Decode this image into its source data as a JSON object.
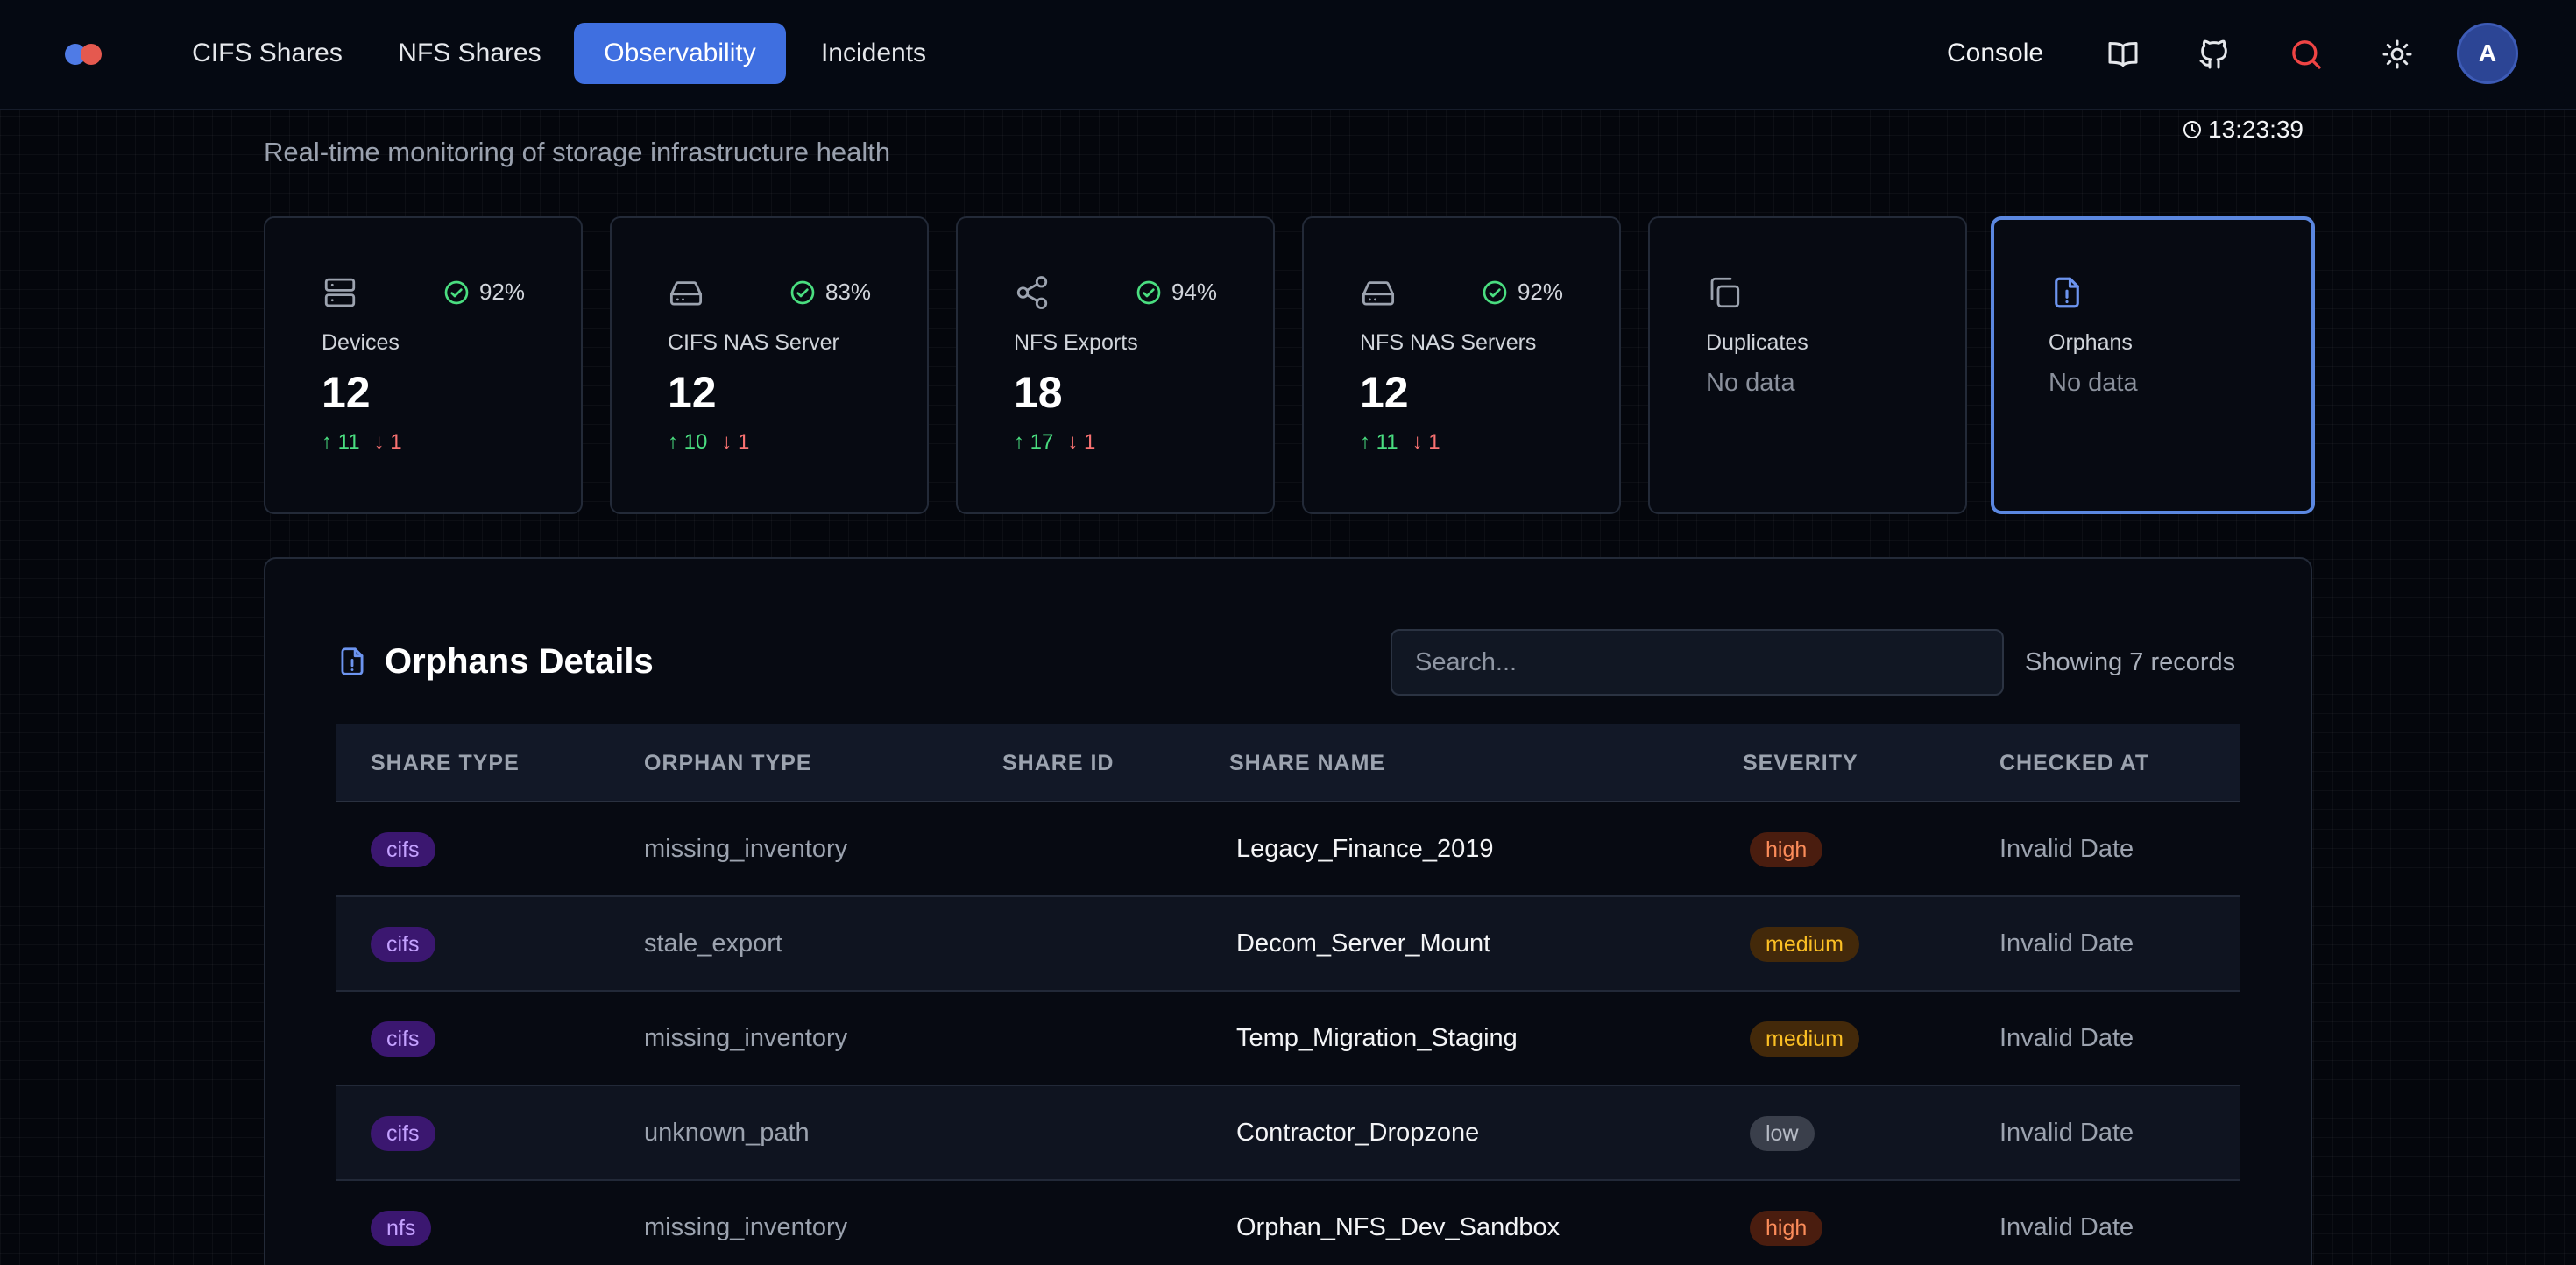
{
  "nav": {
    "tabs": [
      {
        "label": "CIFS Shares",
        "active": false
      },
      {
        "label": "NFS Shares",
        "active": false
      },
      {
        "label": "Observability",
        "active": true
      },
      {
        "label": "Incidents",
        "active": false
      }
    ],
    "console_label": "Console",
    "icons": [
      "book-icon",
      "github-icon",
      "search-icon",
      "sun-icon"
    ],
    "avatar_initial": "A"
  },
  "header": {
    "subtitle": "Real-time monitoring of storage infrastructure health",
    "clock": "13:23:39"
  },
  "cards": [
    {
      "label": "Devices",
      "icon": "server-icon",
      "health": "92%",
      "value": "12",
      "up": "11",
      "down": "1"
    },
    {
      "label": "CIFS NAS Server",
      "icon": "hard-drive-icon",
      "health": "83%",
      "value": "12",
      "up": "10",
      "down": "1"
    },
    {
      "label": "NFS Exports",
      "icon": "share-icon",
      "health": "94%",
      "value": "18",
      "up": "17",
      "down": "1"
    },
    {
      "label": "NFS NAS Servers",
      "icon": "hard-drive-icon",
      "health": "92%",
      "value": "12",
      "up": "11",
      "down": "1"
    },
    {
      "label": "Duplicates",
      "icon": "copy-icon",
      "nodata": "No data"
    },
    {
      "label": "Orphans",
      "icon": "file-alert-icon",
      "nodata": "No data",
      "selected": true
    }
  ],
  "details": {
    "title": "Orphans Details",
    "search_placeholder": "Search...",
    "record_count": "Showing 7 records",
    "columns": [
      "SHARE TYPE",
      "ORPHAN TYPE",
      "SHARE ID",
      "SHARE NAME",
      "SEVERITY",
      "CHECKED AT"
    ],
    "rows": [
      {
        "share_type": "cifs",
        "orphan_type": "missing_inventory",
        "share_id": "",
        "share_name": "Legacy_Finance_2019",
        "severity": "high",
        "checked_at": "Invalid Date"
      },
      {
        "share_type": "cifs",
        "orphan_type": "stale_export",
        "share_id": "",
        "share_name": "Decom_Server_Mount",
        "severity": "medium",
        "checked_at": "Invalid Date"
      },
      {
        "share_type": "cifs",
        "orphan_type": "missing_inventory",
        "share_id": "",
        "share_name": "Temp_Migration_Staging",
        "severity": "medium",
        "checked_at": "Invalid Date"
      },
      {
        "share_type": "cifs",
        "orphan_type": "unknown_path",
        "share_id": "",
        "share_name": "Contractor_Dropzone",
        "severity": "low",
        "checked_at": "Invalid Date"
      },
      {
        "share_type": "nfs",
        "orphan_type": "missing_inventory",
        "share_id": "",
        "share_name": "Orphan_NFS_Dev_Sandbox",
        "severity": "high",
        "checked_at": "Invalid Date"
      }
    ]
  },
  "colors": {
    "accent": "#3f6fe0",
    "healthy": "#4ade80",
    "down": "#f87171",
    "selected_border": "#5b87e0"
  }
}
